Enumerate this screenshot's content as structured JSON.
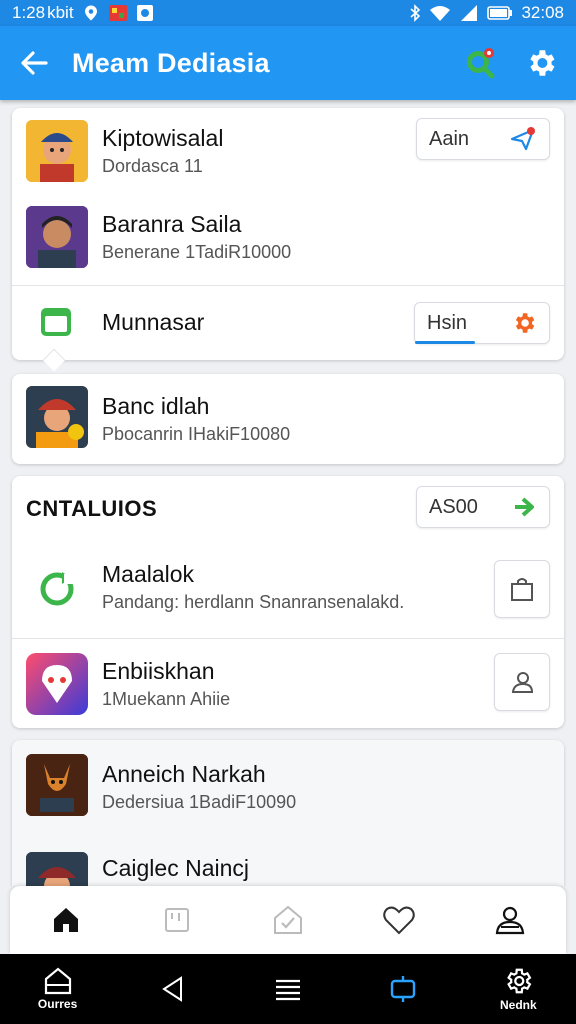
{
  "status_bar": {
    "time": "1:28",
    "carrier": "kbit",
    "clock": "32:08"
  },
  "app_bar": {
    "title": "Meam Dediasia",
    "back_icon": "arrow-left-icon",
    "actions": [
      "location-badge-icon",
      "gear-icon"
    ]
  },
  "group1": [
    {
      "name": "Kiptowisalal",
      "sub": "Dordasca 11",
      "button": "Aain",
      "button_icon": "send-icon"
    },
    {
      "name": "Baranra Saila",
      "sub": "Benerane 1TadiR10000"
    },
    {
      "name": "Munnasar",
      "button": "Hsin",
      "button_icon": "gear-icon"
    }
  ],
  "group2": [
    {
      "name": "Banc idlah",
      "sub": "Pbocanrin IHakiF10080"
    }
  ],
  "section": {
    "title": "CNTALUIOS",
    "button": "AS00",
    "button_icon": "arrow-right-icon"
  },
  "group3": [
    {
      "name": "Maalalok",
      "sub": "Pandang: herdlann Snanransenalakd."
    },
    {
      "name": "Enbiiskhan",
      "sub": "1Muekann Ahiie"
    }
  ],
  "group4": [
    {
      "name": "Anneich Narkah",
      "sub": "Dedersiua 1BadiF10090"
    },
    {
      "name": "Caiglec Naincj"
    }
  ],
  "bottom_nav": [
    "home-icon",
    "tablet-icon",
    "check-icon",
    "heart-icon",
    "profile-icon"
  ],
  "system_nav": {
    "left_label": "Ourres",
    "right_label": "Nednk"
  },
  "colors": {
    "primary": "#2196f3",
    "status_bar": "#1e88e5",
    "accent_orange": "#f26522",
    "accent_green": "#3cb54a"
  }
}
